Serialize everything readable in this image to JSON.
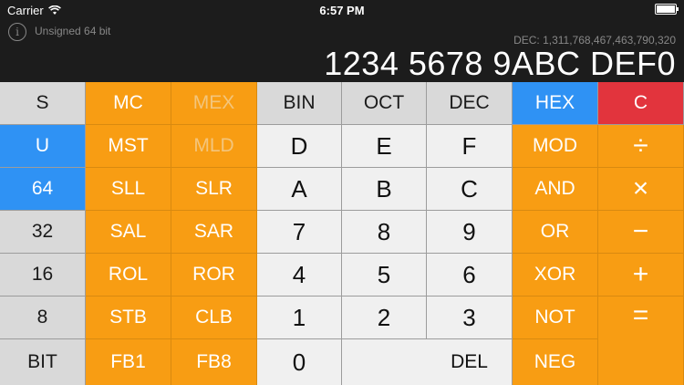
{
  "status_bar": {
    "carrier": "Carrier",
    "time": "6:57 PM"
  },
  "display": {
    "info_icon": "i",
    "mode": "Unsigned 64 bit",
    "decimal": "DEC: 1,311,768,467,463,790,320",
    "value": "1234 5678 9ABC DEF0"
  },
  "keys": {
    "s": "S",
    "mc": "MC",
    "mex": "MEX",
    "bin": "BIN",
    "oct": "OCT",
    "dec": "DEC",
    "hex": "HEX",
    "c": "C",
    "u": "U",
    "mst": "MST",
    "mld": "MLD",
    "d": "D",
    "e": "E",
    "f": "F",
    "mod": "MOD",
    "div": "÷",
    "k64": "64",
    "sll": "SLL",
    "slr": "SLR",
    "a": "A",
    "b": "B",
    "cc": "C",
    "and": "AND",
    "mul": "×",
    "k32": "32",
    "sal": "SAL",
    "sar": "SAR",
    "n7": "7",
    "n8": "8",
    "n9": "9",
    "or": "OR",
    "minus": "−",
    "k16": "16",
    "rol": "ROL",
    "ror": "ROR",
    "n4": "4",
    "n5": "5",
    "n6": "6",
    "xor": "XOR",
    "plus": "+",
    "k8": "8",
    "stb": "STB",
    "clb": "CLB",
    "n1": "1",
    "n2": "2",
    "n3": "3",
    "not": "NOT",
    "equals": "=",
    "bit": "BIT",
    "fb1": "FB1",
    "fb8": "FB8",
    "n0": "0",
    "del": "DEL",
    "neg": "NEG"
  },
  "colors": {
    "orange": "#f89d13",
    "blue": "#2f92f4",
    "red": "#e2343d",
    "gray": "#d9d9d9",
    "light": "#f0f0f0"
  }
}
